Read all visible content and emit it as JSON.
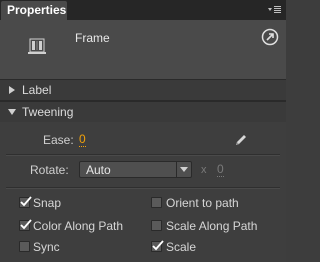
{
  "panel": {
    "tab_label": "Properties",
    "symbol_name": "Frame"
  },
  "sections": {
    "label": "Label",
    "tweening": "Tweening"
  },
  "tweening": {
    "ease_label": "Ease:",
    "ease_value": "0",
    "rotate_label": "Rotate:",
    "rotate_selected": "Auto",
    "rotate_times_symbol": "x",
    "rotate_count": "0"
  },
  "options": [
    {
      "label": "Snap",
      "checked": true
    },
    {
      "label": "Orient to path",
      "checked": false
    },
    {
      "label": "Color Along Path",
      "checked": true
    },
    {
      "label": "Scale Along Path",
      "checked": false
    },
    {
      "label": "Sync",
      "checked": false
    },
    {
      "label": "Scale",
      "checked": true
    }
  ],
  "colors": {
    "accent": "#f0a10a",
    "panel_bg": "#3d3d3d"
  }
}
